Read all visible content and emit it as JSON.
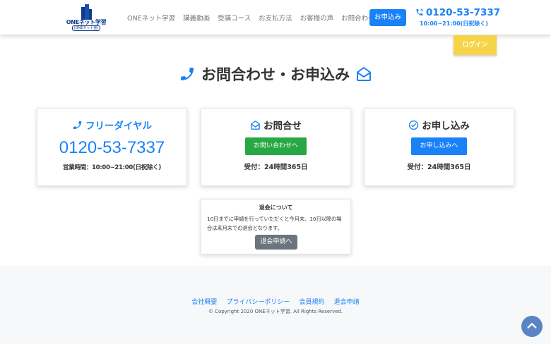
{
  "header": {
    "logo_text": "ONEネット学習",
    "logo_sub": "(ONEネット塾)",
    "nav": [
      {
        "label": "ONEネット学習"
      },
      {
        "label": "講義動画"
      },
      {
        "label": "受講コース"
      },
      {
        "label": "お支払方法"
      },
      {
        "label": "お客様の声"
      },
      {
        "label": "お問合わせ"
      }
    ],
    "apply_label": "お申込み",
    "phone": "0120-53-7337",
    "hours": "10:00~21:00(日祝除く)",
    "login_label": "ログイン"
  },
  "page": {
    "title": "お問合わせ・お申込み"
  },
  "cards": {
    "freedial": {
      "title": "フリーダイヤル",
      "phone": "0120-53-7337",
      "hours": "営業時間：10:00~21:00(日祝除く)"
    },
    "inquiry": {
      "title": "お問合せ",
      "button": "お問い合わせへ",
      "note": "受付：24時間365日"
    },
    "apply": {
      "title": "お申し込み",
      "button": "お申し込みへ",
      "note": "受付：24時間365日"
    }
  },
  "withdraw": {
    "title": "退会について",
    "text": "10日までに申請を行っていただくと今月末、10日以降の場合は来月末での退会となります。",
    "button": "退会申請へ"
  },
  "footer": {
    "links": [
      {
        "label": "会社概要"
      },
      {
        "label": "プライバシーポリシー"
      },
      {
        "label": "会員規約"
      },
      {
        "label": "退会申請"
      }
    ],
    "copyright": "© Copyright 2020 ONEネット学習. All Rights Reserved."
  },
  "colors": {
    "accent": "#1a82f7",
    "green": "#28a745",
    "login": "#f5d547",
    "gray_button": "#6c757d",
    "to_top": "#5b84c4"
  },
  "icons": [
    "phone-icon",
    "envelope-open-icon",
    "check-circle-icon",
    "chevron-up-icon",
    "logo-building-icon"
  ]
}
